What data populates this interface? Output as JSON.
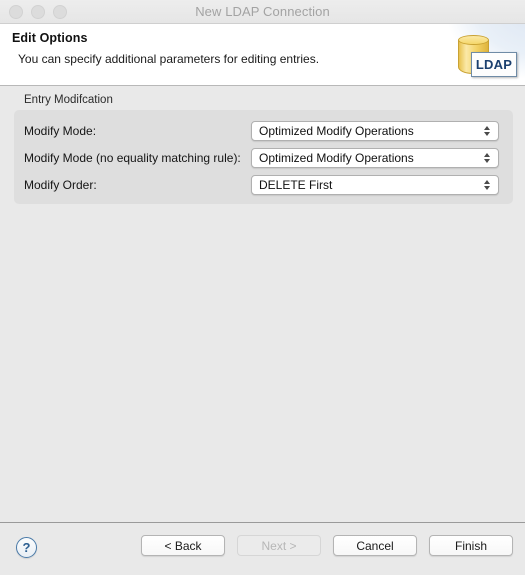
{
  "window": {
    "title": "New LDAP Connection",
    "traffic_lights": [
      "close",
      "minimize",
      "zoom"
    ]
  },
  "header": {
    "title": "Edit Options",
    "description": "You can specify additional parameters for editing entries.",
    "logo_label": "LDAP"
  },
  "main": {
    "group": {
      "label": "Entry Modifcation",
      "rows": [
        {
          "label": "Modify Mode:",
          "value": "Optimized Modify Operations"
        },
        {
          "label": "Modify Mode (no equality matching rule):",
          "value": "Optimized Modify Operations"
        },
        {
          "label": "Modify Order:",
          "value": "DELETE First"
        }
      ]
    }
  },
  "footer": {
    "help_label": "?",
    "buttons": [
      {
        "label": "< Back",
        "enabled": true
      },
      {
        "label": "Next >",
        "enabled": false
      },
      {
        "label": "Cancel",
        "enabled": true
      },
      {
        "label": "Finish",
        "enabled": true
      }
    ]
  },
  "colors": {
    "window_bg": "#e9e9e9",
    "header_bg": "#ffffff",
    "group_bg": "#dedede",
    "accent_blue": "#2c5f91",
    "title_text": "#a3a3a3",
    "ldap_gold": "#f3d368"
  }
}
